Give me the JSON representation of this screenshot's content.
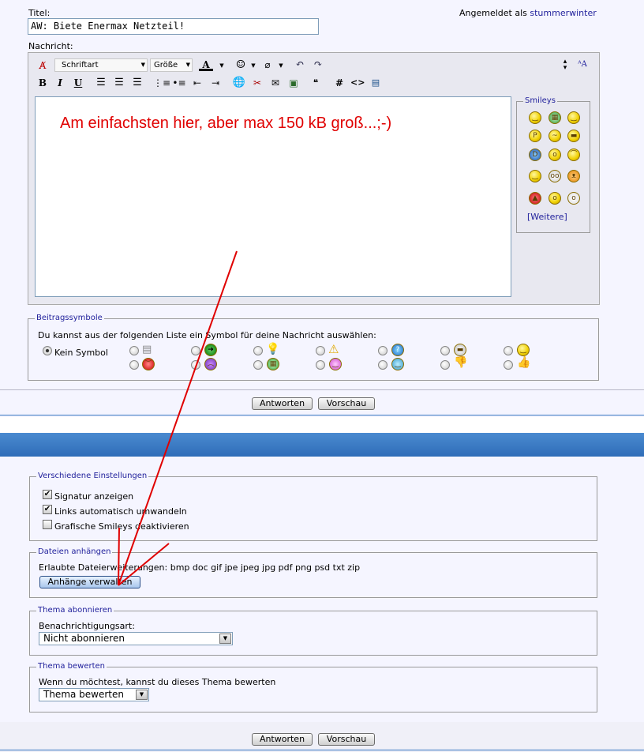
{
  "title_label": "Titel:",
  "title_value": "AW: Biete Enermax Netzteil!",
  "logged_in_label": "Angemeldet als",
  "username": "stummerwinter",
  "message_label": "Nachricht:",
  "toolbar": {
    "font_select": "Schriftart",
    "size_select": "Größe",
    "bold": "B",
    "italic": "I",
    "underline": "U"
  },
  "editor_text": "Am einfachsten hier, aber max 150 kB groß...;-)",
  "smileys": {
    "legend": "Smileys",
    "more_link": "Weitere",
    "bracket_open": "[",
    "bracket_close": "]"
  },
  "post_icons": {
    "legend": "Beitragssymbole",
    "instruction": "Du kannst aus der folgenden Liste ein Symbol für deine Nachricht auswählen:",
    "no_icon": "Kein Symbol"
  },
  "buttons": {
    "reply": "Antworten",
    "preview": "Vorschau"
  },
  "misc_settings": {
    "legend": "Verschiedene Einstellungen",
    "signature": "Signatur anzeigen",
    "links": "Links automatisch umwandeln",
    "smilies_off": "Grafische Smileys deaktivieren"
  },
  "attachments": {
    "legend": "Dateien anhängen",
    "allowed": "Erlaubte Dateierweiterungen: bmp doc gif jpe jpeg jpg pdf png psd txt zip",
    "manage_button": "Anhänge verwalten"
  },
  "subscribe": {
    "legend": "Thema abonnieren",
    "label": "Benachrichtigungsart:",
    "value": "Nicht abonnieren"
  },
  "rate": {
    "legend": "Thema bewerten",
    "label": "Wenn du möchtest, kannst du dieses Thema bewerten",
    "value": "Thema bewerten"
  },
  "colors": {
    "link": "#22229c",
    "annotation_red": "#e00000",
    "bar_blue": "#3a78c2"
  }
}
